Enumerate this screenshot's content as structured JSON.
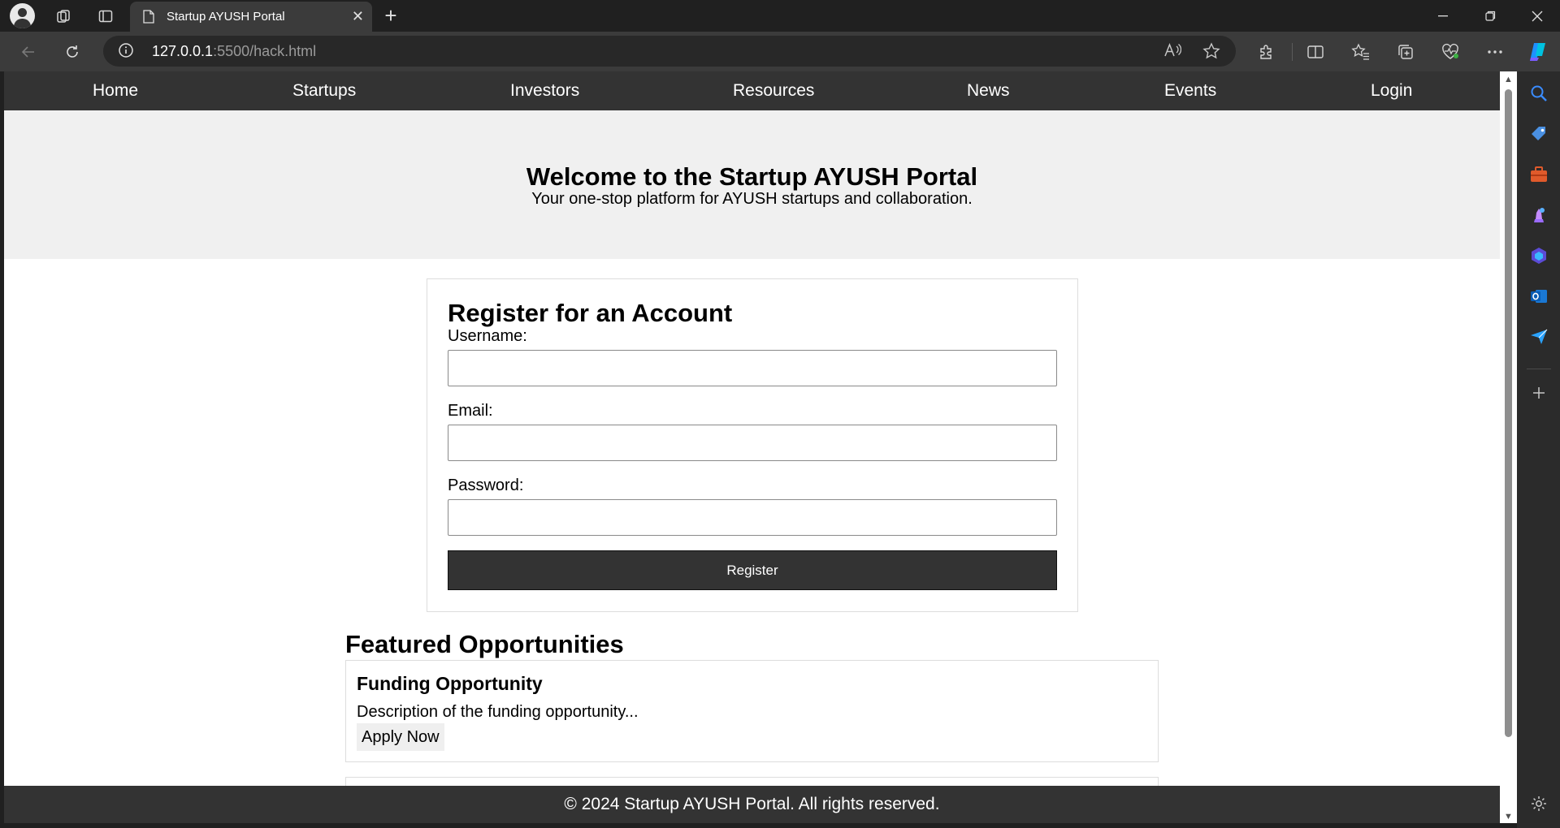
{
  "browser": {
    "tab_title": "Startup AYUSH Portal",
    "url_host": "127.0.0.1",
    "url_path": ":5500/hack.html"
  },
  "site": {
    "nav": [
      "Home",
      "Startups",
      "Investors",
      "Resources",
      "News",
      "Events",
      "Login"
    ],
    "hero": {
      "title": "Welcome to the Startup AYUSH Portal",
      "subtitle": "Your one-stop platform for AYUSH startups and collaboration."
    },
    "register": {
      "title": "Register for an Account",
      "username_label": "Username:",
      "username_value": "",
      "email_label": "Email:",
      "email_value": "",
      "password_label": "Password:",
      "password_value": "",
      "button": "Register"
    },
    "featured": {
      "title": "Featured Opportunities",
      "items": [
        {
          "title": "Funding Opportunity",
          "description": "Description of the funding opportunity...",
          "button": "Apply Now"
        }
      ]
    },
    "footer": "© 2024 Startup AYUSH Portal. All rights reserved."
  },
  "theme": {
    "nav_bg": "#333333",
    "hero_bg": "#f0f0f0",
    "button_bg": "#333333"
  }
}
